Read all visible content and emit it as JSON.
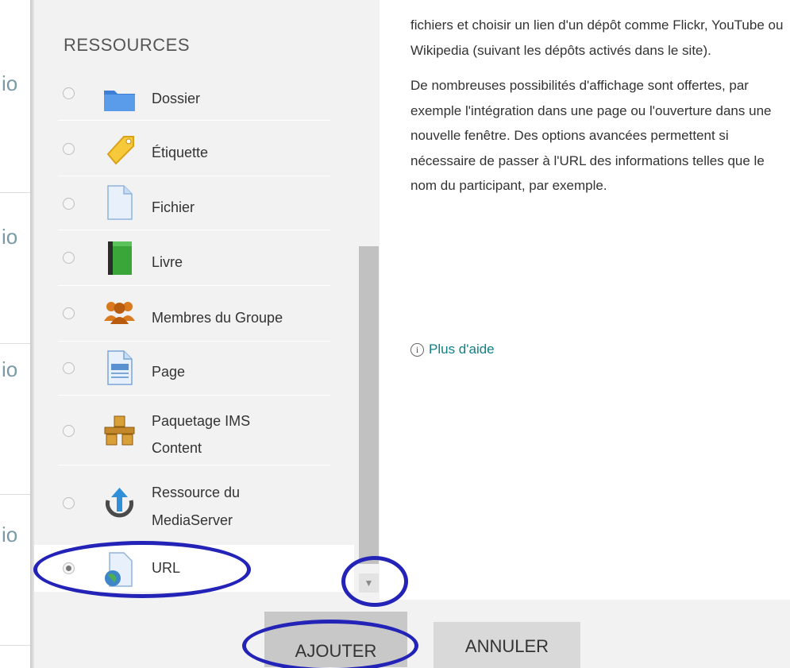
{
  "background": {
    "fragments": [
      "io",
      "io",
      "io",
      "io"
    ]
  },
  "chooser": {
    "section_title": "RESSOURCES",
    "items": [
      {
        "label": "Dossier",
        "icon": "folder-icon",
        "selected": false
      },
      {
        "label": "Étiquette",
        "icon": "label-tag-icon",
        "selected": false
      },
      {
        "label": "Fichier",
        "icon": "file-icon",
        "selected": false
      },
      {
        "label": "Livre",
        "icon": "book-icon",
        "selected": false
      },
      {
        "label": "Membres du Groupe",
        "icon": "group-members-icon",
        "selected": false
      },
      {
        "label": "Page",
        "icon": "page-icon",
        "selected": false
      },
      {
        "label_line1": "Paquetage IMS",
        "label_line2": "Content",
        "icon": "ims-package-icon",
        "selected": false
      },
      {
        "label_line1": "Ressource du",
        "label_line2": "MediaServer",
        "icon": "mediaserver-upload-icon",
        "selected": false
      },
      {
        "label": "URL",
        "icon": "url-globe-icon",
        "selected": true
      }
    ]
  },
  "help": {
    "paragraphs": [
      "fichiers et choisir un lien d'un dépôt comme Flickr, YouTube ou Wikipedia (suivant les dépôts activés dans le site).",
      "De nombreuses possibilités d'affichage sont offertes, par exemple l'intégration dans une page ou l'ouverture dans une nouvelle fenêtre. Des options avancées permettent si nécessaire de passer à l'URL des informations telles que le nom du participant, par exemple."
    ],
    "more_help": "Plus d'aide"
  },
  "footer": {
    "add_label": "AJOUTER",
    "cancel_label": "ANNULER"
  },
  "colors": {
    "annotation": "#2323b8",
    "link": "#0f7f87",
    "panel_bg": "#f2f2f2"
  }
}
